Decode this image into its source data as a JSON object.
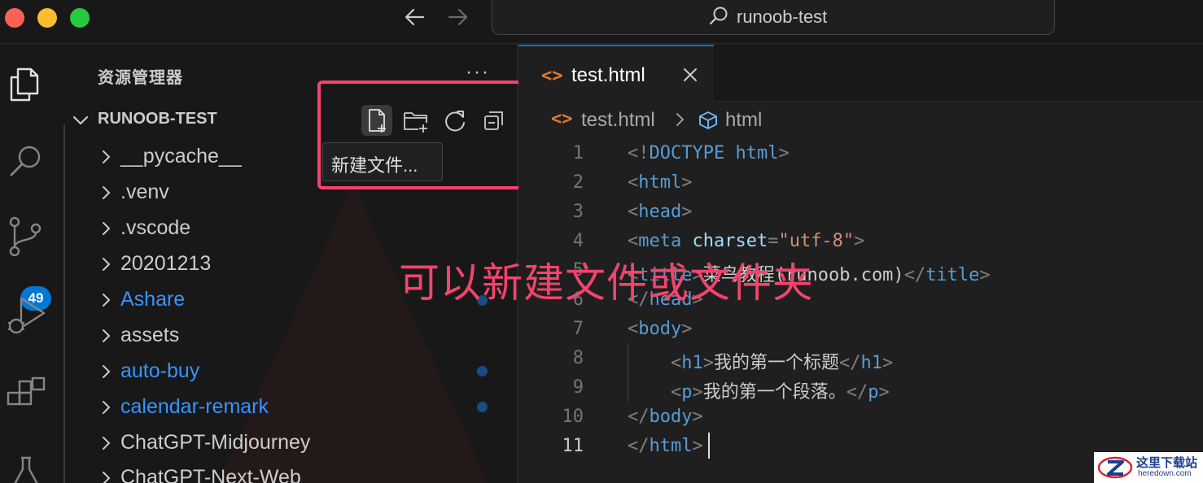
{
  "window": {
    "search_label": "runoob-test"
  },
  "activity_bar": {
    "items": [
      "explorer-icon",
      "search-icon",
      "source-control-icon",
      "run-debug-icon",
      "extensions-icon",
      "testing-icon"
    ],
    "scm_badge": "49"
  },
  "sidebar": {
    "title": "资源管理器",
    "more": "···",
    "folder": "RUNOOB-TEST",
    "toolbar": {
      "tooltip": "新建文件..."
    },
    "items": [
      {
        "label": "__pycache__",
        "modified": false
      },
      {
        "label": ".venv",
        "modified": false
      },
      {
        "label": ".vscode",
        "modified": false
      },
      {
        "label": "20201213",
        "modified": false
      },
      {
        "label": "Ashare",
        "modified": true
      },
      {
        "label": "assets",
        "modified": false
      },
      {
        "label": "auto-buy",
        "modified": true
      },
      {
        "label": "calendar-remark",
        "modified": true
      },
      {
        "label": "ChatGPT-Midjourney",
        "modified": false
      },
      {
        "label": "ChatGPT-Next-Web",
        "modified": false
      }
    ]
  },
  "editor": {
    "tab": {
      "icon": "<>",
      "label": "test.html"
    },
    "breadcrumb": {
      "icon": "<>",
      "file": "test.html",
      "symbol": "html"
    },
    "line_numbers": [
      "1",
      "2",
      "3",
      "4",
      "5",
      "6",
      "7",
      "8",
      "9",
      "10",
      "11"
    ],
    "current_line": 11,
    "code": {
      "l1": {
        "open": "<!",
        "kw": "DOCTYPE",
        "attr": " html",
        "close": ">"
      },
      "l2": {
        "open": "<",
        "tag": "html",
        "close": ">"
      },
      "l3": {
        "open": "<",
        "tag": "head",
        "close": ">"
      },
      "l4": {
        "open": "<",
        "tag": "meta",
        "attr": " charset",
        "eq": "=",
        "str": "\"utf-8\"",
        "close": ">"
      },
      "l5": {
        "open": "<",
        "tag": "title",
        "close": ">",
        "text": "菜鸟教程(runoob.com)",
        "open2": "</",
        "tag2": "title",
        "close2": ">"
      },
      "l6": {
        "open": "</",
        "tag": "head",
        "close": ">"
      },
      "l7": {
        "open": "<",
        "tag": "body",
        "close": ">"
      },
      "l8": {
        "indent": "    ",
        "open": "<",
        "tag": "h1",
        "close": ">",
        "text": "我的第一个标题",
        "open2": "</",
        "tag2": "h1",
        "close2": ">"
      },
      "l9": {
        "indent": "    ",
        "open": "<",
        "tag": "p",
        "close": ">",
        "text": "我的第一个段落。",
        "open2": "</",
        "tag2": "p",
        "close2": ">"
      },
      "l10": {
        "open": "</",
        "tag": "body",
        "close": ">"
      },
      "l11": {
        "open": "</",
        "tag": "html",
        "close": ">"
      }
    }
  },
  "annotation": {
    "text": "可以新建文件或文件夹",
    "color": "#f4436c"
  },
  "watermark": {
    "title": "这里下载站",
    "url": "heredown.com"
  },
  "colors": {
    "accent": "#0078d4",
    "modified": "#3794ff",
    "tag": "#569cd6",
    "attribute": "#9cdcfe",
    "string": "#ce9178",
    "file_icon": "#e37933"
  }
}
